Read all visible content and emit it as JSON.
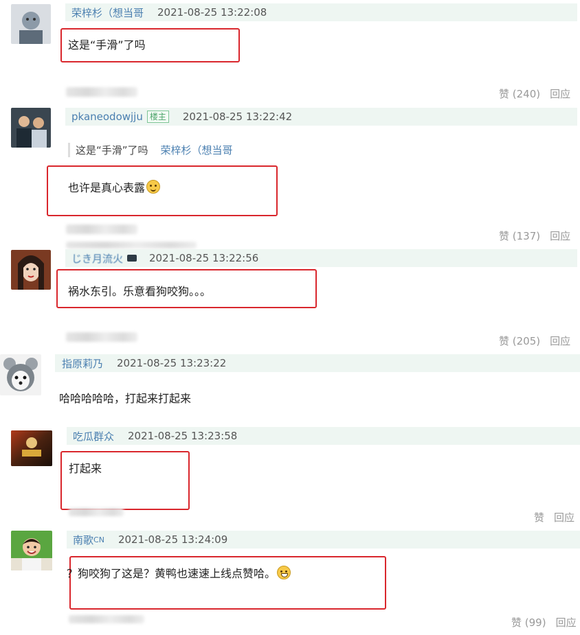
{
  "comments": [
    {
      "user": "荣梓杉（想当哥",
      "time": "2021-08-25 13:22:08",
      "text": "这是“手滑”了吗",
      "likes": "赞 (240)",
      "reply": "回应"
    },
    {
      "user": "pkaneodowjju",
      "badge": "楼主",
      "time": "2021-08-25 13:22:42",
      "quote_text": "这是“手滑”了吗",
      "quote_user": "荣梓杉（想当哥",
      "text": "也许是真心表露",
      "likes": "赞 (137)",
      "reply": "回应"
    },
    {
      "user": "じき月流火",
      "time": "2021-08-25 13:22:56",
      "text": "祸水东引。乐意看狗咬狗。。。",
      "likes": "赞 (205)",
      "reply": "回应"
    },
    {
      "user": "指原莉乃",
      "time": "2021-08-25 13:23:22",
      "text": "哈哈哈哈哈，打起来打起来"
    },
    {
      "user": "吃瓜群众",
      "time": "2021-08-25 13:23:58",
      "text": "打起来",
      "likes": "赞",
      "reply": "回应"
    },
    {
      "user": "南歌",
      "user_suffix": "CN",
      "time": "2021-08-25 13:24:09",
      "text": "？狗咬狗了这是？黄鸭也速速上线点赞哈。",
      "likes": "赞 (99)",
      "reply": "回应"
    }
  ],
  "icons": {
    "smile": "smile-emoji-icon",
    "grin": "grin-emoji-icon"
  },
  "colors": {
    "highlight_box": "#d9262c",
    "username": "#4a7fb0",
    "header_bg": "#eef6f2"
  }
}
